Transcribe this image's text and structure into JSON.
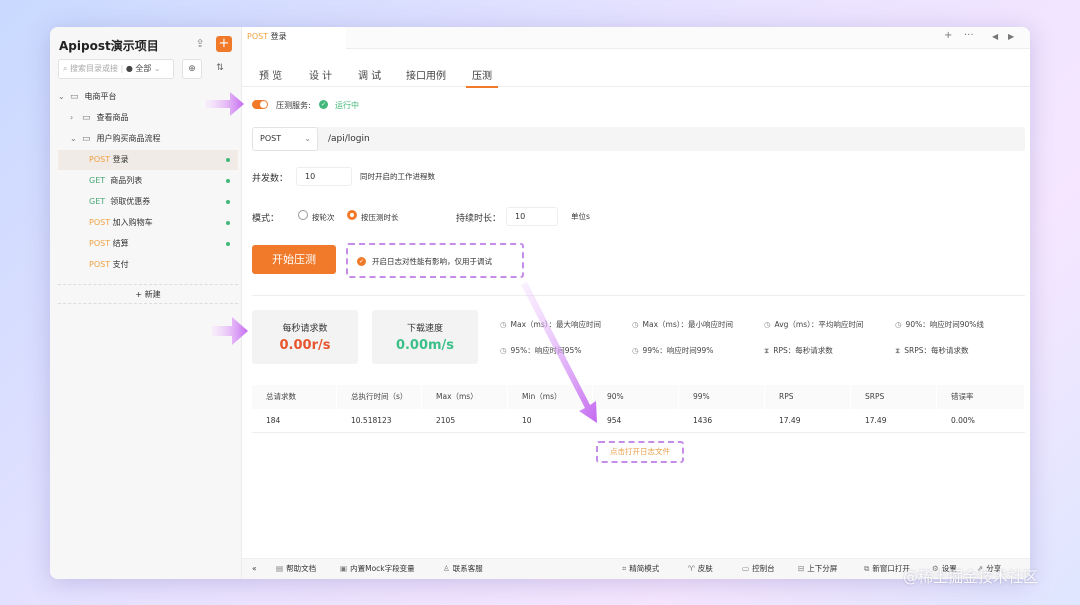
{
  "sidebar": {
    "project_title": "Apipost演示项目",
    "search_placeholder": "搜索目录或接",
    "scope": "全部",
    "tree": [
      {
        "label": "电商平台"
      },
      {
        "label": "查看商品"
      },
      {
        "label": "用户购买商品流程"
      },
      {
        "method": "POST",
        "label": "登录"
      },
      {
        "method": "GET",
        "label": "商品列表"
      },
      {
        "method": "GET",
        "label": "领取优惠券"
      },
      {
        "method": "POST",
        "label": "加入购物车"
      },
      {
        "method": "POST",
        "label": "结算"
      },
      {
        "method": "POST",
        "label": "支付"
      }
    ],
    "new_label": "新建"
  },
  "tab": {
    "method": "POST",
    "title": "登录"
  },
  "subtabs": [
    "预 览",
    "设 计",
    "调 试",
    "接口用例",
    "压测"
  ],
  "service": {
    "label": "压测服务:",
    "status": "运行中"
  },
  "request": {
    "method": "POST",
    "url": "/api/login"
  },
  "concurrency": {
    "label": "并发数：",
    "value": "10",
    "hint": "同时开启的工作进程数"
  },
  "mode": {
    "label": "模式：",
    "opt1": "按轮次",
    "opt2": "按压测时长",
    "duration_label": "持续时长：",
    "duration_value": "10",
    "unit": "单位s"
  },
  "start_button": "开始压测",
  "log_checkbox": "开启日志对性能有影响，仅用于调试",
  "stats": {
    "rps_title": "每秒请求数",
    "rps_value": "0.00r/s",
    "speed_title": "下载速度",
    "speed_value": "0.00m/s"
  },
  "legend": [
    "Max（ms）：最大响应时间",
    "Max（ms）：最小响应时间",
    "Avg（ms）：平均响应时间",
    "90%：响应时间90%线",
    "95%：响应时间95%",
    "99%：响应时间99%",
    "RPS：每秒请求数",
    "SRPS：每秒请求数"
  ],
  "table": {
    "headers": [
      "总请求数",
      "总执行时间（s）",
      "Max（ms）",
      "Min（ms）",
      "90%",
      "99%",
      "RPS",
      "SRPS",
      "错误率"
    ],
    "row": [
      "184",
      "10.518123",
      "2105",
      "10",
      "954",
      "1436",
      "17.49",
      "17.49",
      "0.00%"
    ]
  },
  "open_log": "点击打开日志文件",
  "bottom_bar": {
    "help": "帮助文档",
    "mock": "内置Mock字段变量",
    "support": "联系客服",
    "simple": "精简模式",
    "skin": "皮肤",
    "console": "控制台",
    "split": "上下分屏",
    "new_window": "新窗口打开",
    "settings": "设置",
    "share": "分享"
  },
  "watermark": "@稀土掘金技术社区",
  "colors": {
    "accent": "#f07a2a",
    "success": "#42b87a",
    "rps": "#e7562e",
    "speed": "#3cc08a",
    "annotation": "#c58de8"
  }
}
